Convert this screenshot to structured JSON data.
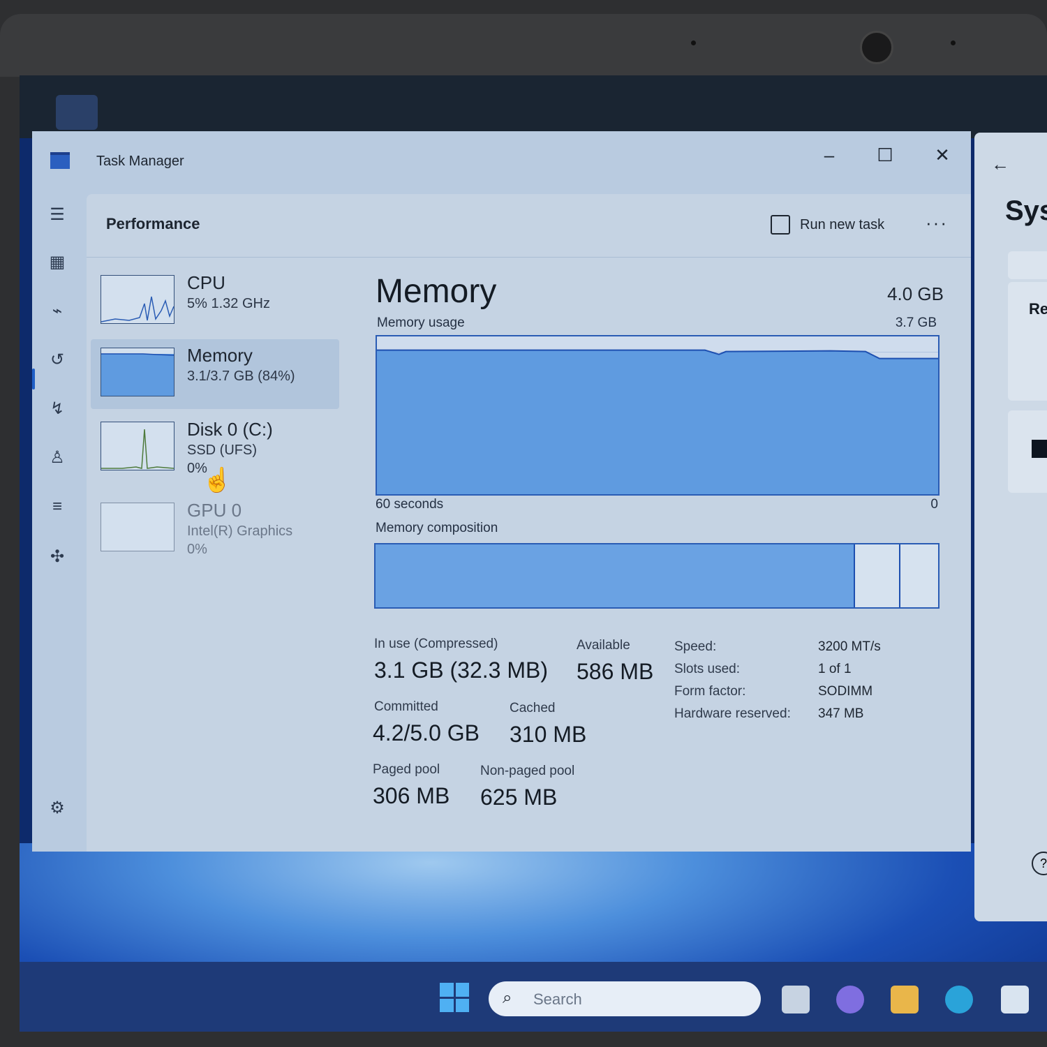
{
  "window": {
    "title": "Task Manager",
    "minimize_icon": "minimize-icon",
    "maximize_icon": "maximize-icon",
    "close_icon": "close-icon"
  },
  "header": {
    "title": "Performance",
    "run_new_task": "Run new task",
    "more_icon": "more-icon"
  },
  "nav_rail": [
    {
      "icon": "hamburger-menu-icon"
    },
    {
      "icon": "processes-icon"
    },
    {
      "icon": "performance-icon"
    },
    {
      "icon": "app-history-icon"
    },
    {
      "icon": "startup-apps-icon"
    },
    {
      "icon": "users-icon"
    },
    {
      "icon": "details-icon"
    },
    {
      "icon": "services-icon"
    },
    {
      "icon": "settings-icon"
    }
  ],
  "devices": [
    {
      "name": "CPU",
      "line1": "5%  1.32 GHz",
      "line2": ""
    },
    {
      "name": "Memory",
      "line1": "3.1/3.7 GB (84%)",
      "line2": ""
    },
    {
      "name": "Disk 0 (C:)",
      "line1": "SSD (UFS)",
      "line2": "0%"
    },
    {
      "name": "GPU 0",
      "line1": "Intel(R) Graphics",
      "line2": "0%"
    }
  ],
  "memory": {
    "title": "Memory",
    "total": "4.0 GB",
    "usage_label": "Memory usage",
    "usage_max": "3.7 GB",
    "time_left": "60 seconds",
    "time_right": "0",
    "composition_label": "Memory composition",
    "composition": {
      "in_use_fraction": 0.85,
      "modified_fraction": 0.08,
      "standby_fraction": 0.07
    },
    "usage_fraction": 0.84,
    "stats": {
      "in_use_label": "In use (Compressed)",
      "in_use_value": "3.1 GB (32.3 MB)",
      "available_label": "Available",
      "available_value": "586 MB",
      "committed_label": "Committed",
      "committed_value": "4.2/5.0 GB",
      "cached_label": "Cached",
      "cached_value": "310 MB",
      "paged_label": "Paged pool",
      "paged_value": "306 MB",
      "nonpaged_label": "Non-paged pool",
      "nonpaged_value": "625 MB"
    },
    "specs": [
      {
        "key": "Speed:",
        "value": "3200 MT/s"
      },
      {
        "key": "Slots used:",
        "value": "1 of 1"
      },
      {
        "key": "Form factor:",
        "value": "SODIMM"
      },
      {
        "key": "Hardware reserved:",
        "value": "347 MB"
      }
    ]
  },
  "side_window": {
    "title": "Sys",
    "item": "Re"
  },
  "taskbar": {
    "search_placeholder": "Search"
  },
  "colors": {
    "accent": "#1f5fc7",
    "memory_fill": "#5f9be0"
  }
}
